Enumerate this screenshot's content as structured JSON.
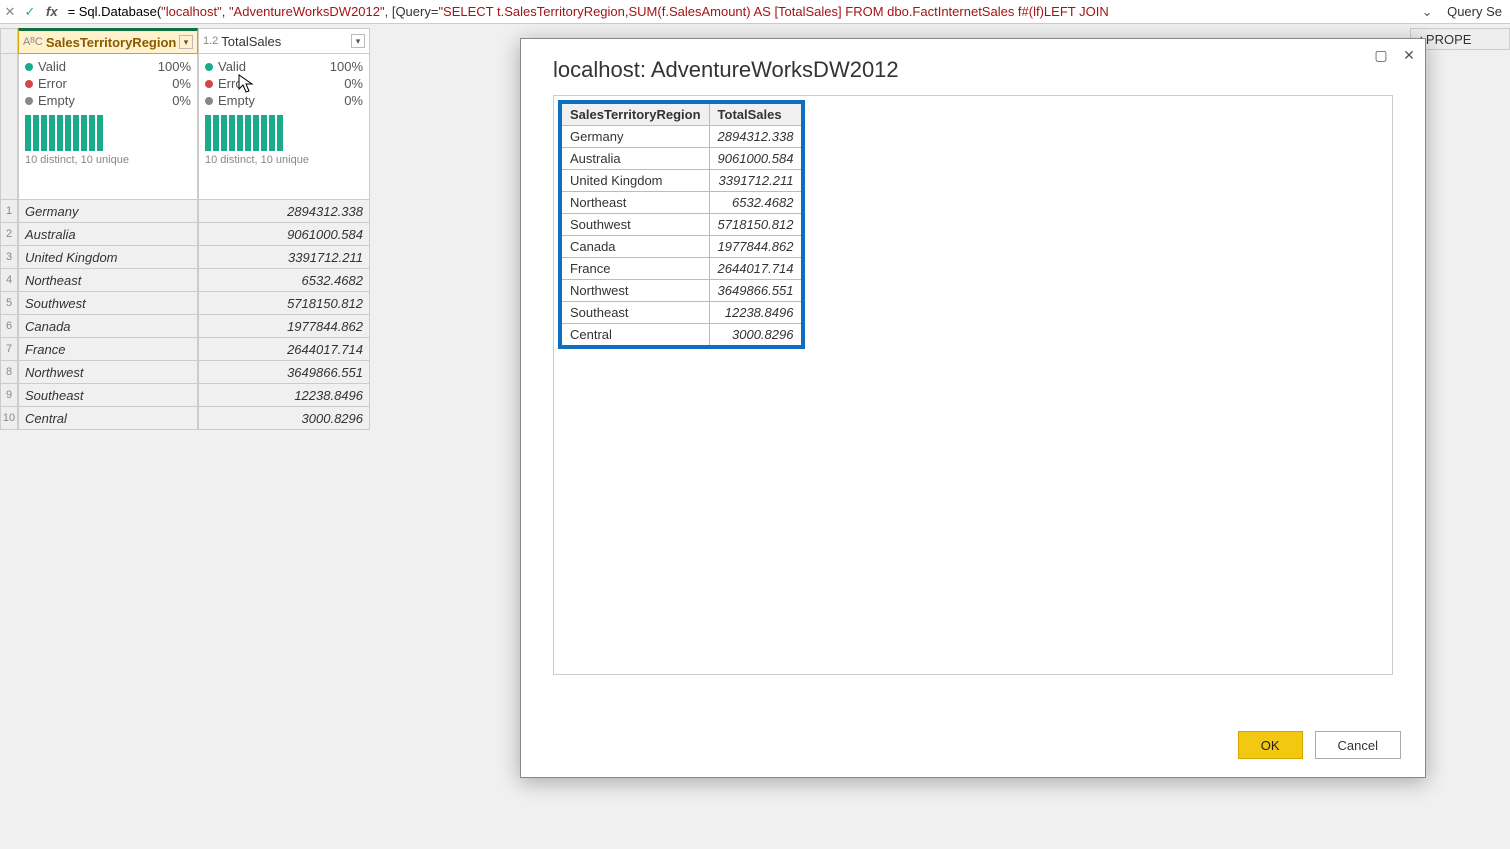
{
  "formula_bar": {
    "fx_label": "fx",
    "text_prefix": "= Sql.Database(",
    "str1": "\"localhost\"",
    "comma1": ", ",
    "str2": "\"AdventureWorksDW2012\"",
    "mid": ", [Query=",
    "str3": "\"SELECT t.SalesTerritoryRegion,SUM(f.SalesAmount) AS [TotalSales] FROM dbo.FactInternetSales f#(lf)LEFT JOIN",
    "right_label": "Query Se"
  },
  "columns": {
    "c1": {
      "type": "AᴮC",
      "name": "SalesTerritoryRegion"
    },
    "c2": {
      "type": "1.2",
      "name": "TotalSales"
    }
  },
  "quality": {
    "valid_label": "Valid",
    "error_label": "Error",
    "empty_label": "Empty",
    "c1": {
      "valid": "100%",
      "error": "0%",
      "empty": "0%",
      "dist": "10 distinct, 10 unique"
    },
    "c2": {
      "valid": "100%",
      "error": "0%",
      "empty": "0%",
      "dist": "10 distinct, 10 unique"
    }
  },
  "rows": [
    {
      "n": "1",
      "region": "Germany",
      "sales": "2894312.338"
    },
    {
      "n": "2",
      "region": "Australia",
      "sales": "9061000.584"
    },
    {
      "n": "3",
      "region": "United Kingdom",
      "sales": "3391712.211"
    },
    {
      "n": "4",
      "region": "Northeast",
      "sales": "6532.4682"
    },
    {
      "n": "5",
      "region": "Southwest",
      "sales": "5718150.812"
    },
    {
      "n": "6",
      "region": "Canada",
      "sales": "1977844.862"
    },
    {
      "n": "7",
      "region": "France",
      "sales": "2644017.714"
    },
    {
      "n": "8",
      "region": "Northwest",
      "sales": "3649866.551"
    },
    {
      "n": "9",
      "region": "Southeast",
      "sales": "12238.8496"
    },
    {
      "n": "10",
      "region": "Central",
      "sales": "3000.8296"
    }
  ],
  "properties_label": "PROPE",
  "dialog": {
    "title": "localhost: AdventureWorksDW2012",
    "col1": "SalesTerritoryRegion",
    "col2": "TotalSales",
    "ok": "OK",
    "cancel": "Cancel"
  }
}
